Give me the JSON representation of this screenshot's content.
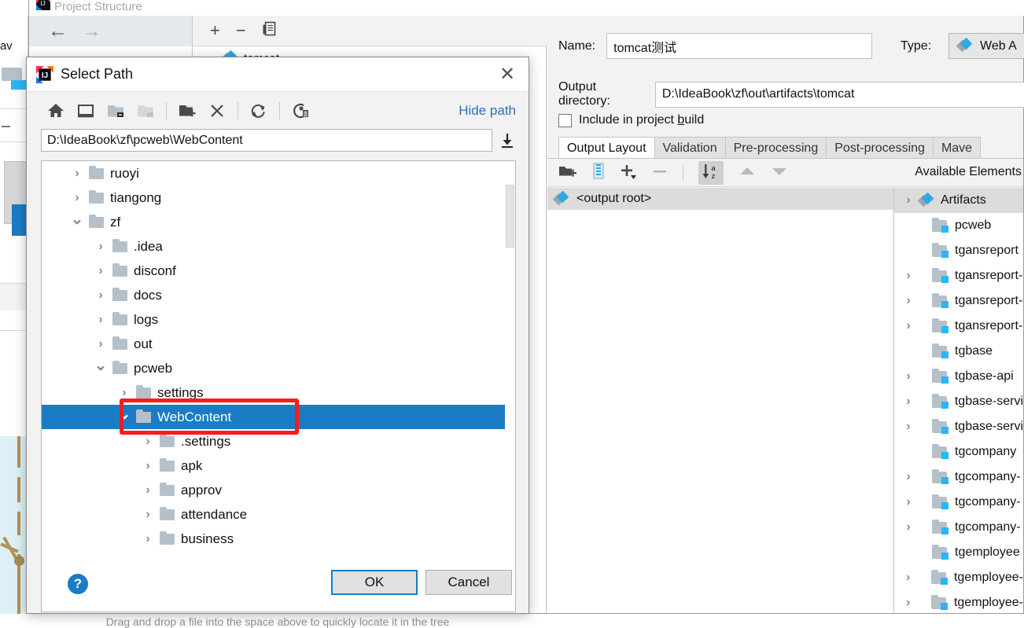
{
  "background_window": {
    "title": "Project Structure",
    "nav": {
      "back_icon": "arrow-left-icon",
      "forward_icon": "arrow-right-icon"
    },
    "artifacts_toolbar": {
      "add": "+",
      "remove": "−",
      "copy_icon": "copy-icon"
    },
    "artifact_entry": "tomcat",
    "left_edge_text": "av"
  },
  "detail": {
    "name_label": "Name:",
    "name_value": "tomcat测试",
    "type_label": "Type:",
    "type_value": "Web A",
    "type_icon": "artifact-diamonds-icon",
    "output_dir_label": "Output directory:",
    "output_dir_value": "D:\\IdeaBook\\zf\\out\\artifacts\\tomcat",
    "include_checkbox_label_pre": "Include in project ",
    "include_checkbox_label_mnemonic": "b",
    "include_checkbox_label_post": "uild",
    "include_checked": false,
    "tabs": [
      {
        "label": "Output Layout",
        "active": true
      },
      {
        "label": "Validation",
        "active": false
      },
      {
        "label": "Pre-processing",
        "active": false
      },
      {
        "label": "Post-processing",
        "active": false
      },
      {
        "label": "Mave",
        "active": false
      }
    ],
    "layout_toolbar": [
      {
        "name": "create-directory-icon",
        "glyph": "folder-plus"
      },
      {
        "name": "create-archive-icon",
        "glyph": "archive"
      },
      {
        "name": "add-copy-icon",
        "glyph": "plus-dropdown"
      },
      {
        "name": "remove-icon",
        "glyph": "minus"
      },
      {
        "name": "sort-az-icon",
        "glyph": "sort-az"
      },
      {
        "name": "move-up-icon",
        "glyph": "triangle-up"
      },
      {
        "name": "move-down-icon",
        "glyph": "triangle-down"
      }
    ],
    "output_root_label": "<output root>",
    "available_elements_label": "Available Elements",
    "available_elements": [
      {
        "label": "Artifacts",
        "icon": "diamonds",
        "expandable": true,
        "indent": 0,
        "band": true
      },
      {
        "label": "pcweb",
        "icon": "module",
        "expandable": false,
        "indent": 1
      },
      {
        "label": "tgansreport",
        "icon": "module",
        "expandable": false,
        "indent": 1
      },
      {
        "label": "tgansreport-",
        "icon": "module",
        "expandable": true,
        "indent": 1
      },
      {
        "label": "tgansreport-",
        "icon": "module",
        "expandable": true,
        "indent": 1
      },
      {
        "label": "tgansreport-",
        "icon": "module",
        "expandable": true,
        "indent": 1
      },
      {
        "label": "tgbase",
        "icon": "module",
        "expandable": false,
        "indent": 1
      },
      {
        "label": "tgbase-api",
        "icon": "module",
        "expandable": true,
        "indent": 1
      },
      {
        "label": "tgbase-servi",
        "icon": "module",
        "expandable": true,
        "indent": 1
      },
      {
        "label": "tgbase-servi",
        "icon": "module",
        "expandable": true,
        "indent": 1
      },
      {
        "label": "tgcompany",
        "icon": "module",
        "expandable": false,
        "indent": 1
      },
      {
        "label": "tgcompany-",
        "icon": "module",
        "expandable": true,
        "indent": 1
      },
      {
        "label": "tgcompany-",
        "icon": "module",
        "expandable": true,
        "indent": 1
      },
      {
        "label": "tgcompany-",
        "icon": "module",
        "expandable": true,
        "indent": 1
      },
      {
        "label": "tgemployee",
        "icon": "module",
        "expandable": false,
        "indent": 1
      },
      {
        "label": "tgemployee-",
        "icon": "module",
        "expandable": true,
        "indent": 1
      },
      {
        "label": "tgemployee-",
        "icon": "module",
        "expandable": true,
        "indent": 1
      }
    ]
  },
  "dialog": {
    "title": "Select Path",
    "title_icon": "intellij-idea-icon",
    "close_icon": "close-icon",
    "toolbar": [
      {
        "name": "home-icon",
        "glyph": "home"
      },
      {
        "name": "desktop-icon",
        "glyph": "desktop"
      },
      {
        "name": "project-folder-icon",
        "glyph": "folder-dark-badge"
      },
      {
        "name": "module-folder-icon",
        "glyph": "folder-light-badge"
      },
      {
        "name": "new-folder-icon",
        "glyph": "folder-plus"
      },
      {
        "name": "delete-icon",
        "glyph": "x"
      },
      {
        "name": "refresh-icon",
        "glyph": "refresh"
      },
      {
        "name": "show-hidden-icon",
        "glyph": "eye-list"
      }
    ],
    "hide_path_label": "Hide path",
    "path_value": "D:\\IdeaBook\\zf\\pcweb\\WebContent",
    "path_download_icon": "download-icon",
    "tree": [
      {
        "label": "ruoyi",
        "indent": 1,
        "state": "collapsed",
        "selected": false
      },
      {
        "label": "tiangong",
        "indent": 1,
        "state": "collapsed",
        "selected": false
      },
      {
        "label": "zf",
        "indent": 1,
        "state": "expanded",
        "selected": false
      },
      {
        "label": ".idea",
        "indent": 2,
        "state": "collapsed",
        "selected": false
      },
      {
        "label": "disconf",
        "indent": 2,
        "state": "collapsed",
        "selected": false
      },
      {
        "label": "docs",
        "indent": 2,
        "state": "collapsed",
        "selected": false
      },
      {
        "label": "logs",
        "indent": 2,
        "state": "collapsed",
        "selected": false
      },
      {
        "label": "out",
        "indent": 2,
        "state": "collapsed",
        "selected": false
      },
      {
        "label": "pcweb",
        "indent": 2,
        "state": "expanded",
        "selected": false
      },
      {
        "label": "settings",
        "indent": 3,
        "state": "collapsed",
        "selected": false
      },
      {
        "label": "WebContent",
        "indent": 3,
        "state": "expanded",
        "selected": true
      },
      {
        "label": ".settings",
        "indent": 4,
        "state": "collapsed",
        "selected": false
      },
      {
        "label": "apk",
        "indent": 4,
        "state": "collapsed",
        "selected": false
      },
      {
        "label": "approv",
        "indent": 4,
        "state": "collapsed",
        "selected": false
      },
      {
        "label": "attendance",
        "indent": 4,
        "state": "collapsed",
        "selected": false
      },
      {
        "label": "business",
        "indent": 4,
        "state": "collapsed",
        "selected": false
      }
    ],
    "drag_hint": "Drag and drop a file into the space above to quickly locate it in the tree",
    "help_label": "?",
    "ok_label": "OK",
    "cancel_label": "Cancel"
  },
  "colors": {
    "selection_blue": "#1a7cc4",
    "annotation_red": "#ff1a1a",
    "link_blue": "#2b6fbd",
    "folder_gray": "#b6c0c9",
    "module_badge": "#29b6f6",
    "panel_gray": "#f2f2f2"
  }
}
